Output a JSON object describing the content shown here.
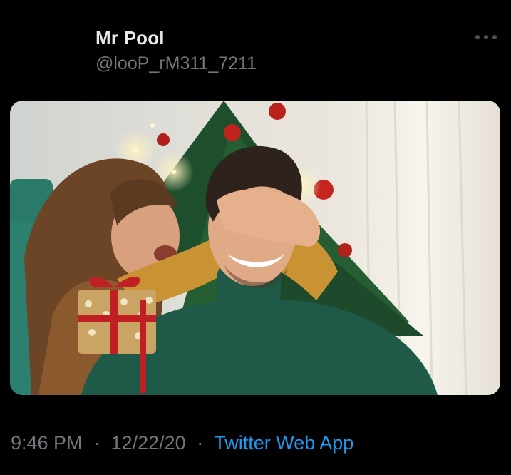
{
  "tweet": {
    "author": {
      "display_name": "Mr Pool",
      "handle": "@looP_rM311_7211"
    },
    "media": {
      "icon": "photo-christmas-gift-surprise"
    },
    "meta": {
      "time": "9:46 PM",
      "date": "12/22/20",
      "separator": "·",
      "source": "Twitter Web App"
    },
    "colors": {
      "background": "#000000",
      "primary_text": "#e7e9ea",
      "secondary_text": "#71767b",
      "link": "#1d9bf0"
    }
  }
}
